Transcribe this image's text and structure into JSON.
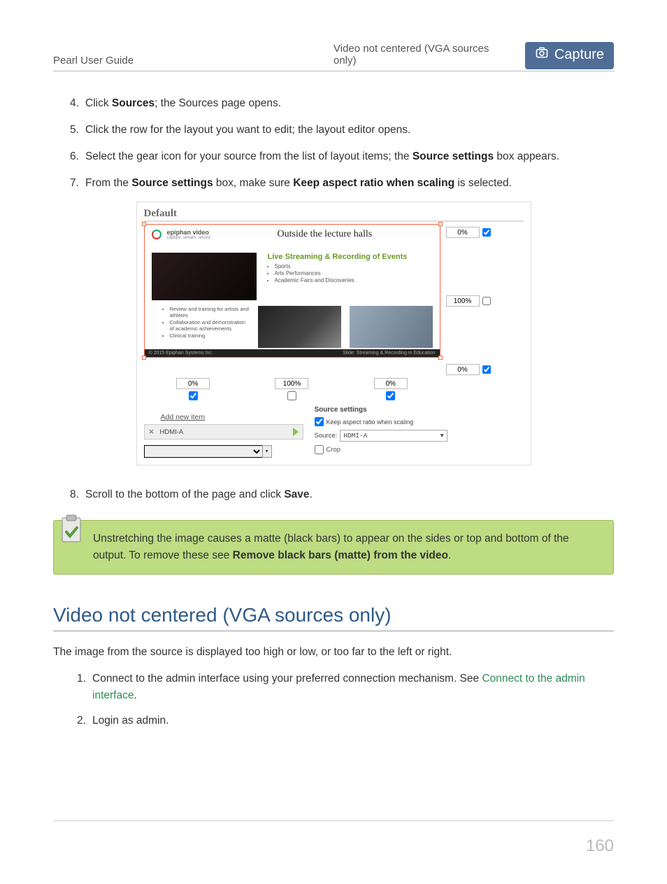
{
  "header": {
    "left": "Pearl User Guide",
    "center": "Video not centered (VGA sources only)",
    "tab": "Capture"
  },
  "steps": {
    "s4_a": "Click ",
    "s4_b": "Sources",
    "s4_c": "; the Sources page opens.",
    "s5": "Click the row for the layout you want to edit; the layout editor opens.",
    "s6_a": "Select the gear icon for your source from the list of layout items; the ",
    "s6_b": "Source settings",
    "s6_c": " box appears.",
    "s7_a": "From the ",
    "s7_b": "Source settings",
    "s7_c": " box, make sure ",
    "s7_d": "Keep aspect ratio when scaling",
    "s7_e": " is selected.",
    "s8_a": "Scroll to the bottom of the page and click ",
    "s8_b": "Save",
    "s8_c": "."
  },
  "figure": {
    "default": "Default",
    "brand": "epiphan video",
    "brand_sub": "capture. stream. record.",
    "lecture": "Outside the lecture halls",
    "green": "Live Streaming & Recording of Events",
    "b1": "Sports",
    "b2": "Arts Performances",
    "b3": "Academic Fairs and Discoveries",
    "lb1": "Review and training for artists and athletes",
    "lb2": "Collaboration and demonstration of academic achievements",
    "lb3": "Clinical training",
    "foot_left": "© 2015 Epiphan Systems Inc.",
    "foot_right": "Slide: Streaming & Recording in Education",
    "pct0": "0%",
    "pct100": "100%",
    "add_item": "Add new item",
    "item_name": "HDMI-A",
    "settings_title": "Source settings",
    "keep_aspect": "Keep aspect ratio when scaling",
    "source_lbl": "Source:",
    "source_val": "HDMI-A",
    "crop": "Crop"
  },
  "note": {
    "t1": "Unstretching the image causes a matte (black bars) to appear on the sides or top and bottom of the output. To remove these see ",
    "t2": "Remove black bars (matte) from the video",
    "t3": "."
  },
  "section": {
    "title": "Video not centered (VGA sources only)",
    "intro": "The image from the source is displayed too high or low, or too far to the left or right.",
    "s1_a": "Connect to the admin interface using your preferred connection mechanism. See ",
    "s1_link": "Connect to the admin interface",
    "s1_c": ".",
    "s2": "Login as admin."
  },
  "page_number": "160"
}
